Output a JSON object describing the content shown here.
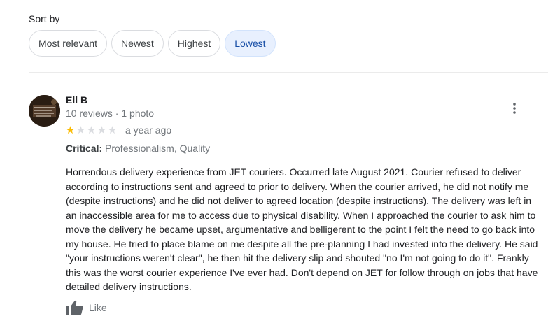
{
  "sort": {
    "label": "Sort by",
    "options": [
      {
        "label": "Most relevant",
        "active": false
      },
      {
        "label": "Newest",
        "active": false
      },
      {
        "label": "Highest",
        "active": false
      },
      {
        "label": "Lowest",
        "active": true
      }
    ]
  },
  "review": {
    "author": "Ell B",
    "meta": "10 reviews · 1 photo",
    "rating": 1,
    "rating_max": 5,
    "time": "a year ago",
    "critical_label": "Critical:",
    "critical_values": "Professionalism, Quality",
    "text": "Horrendous delivery experience from JET couriers. Occurred late August 2021. Courier refused to deliver according to instructions sent and agreed to prior to delivery. When the courier arrived, he did not notify me (despite instructions) and he did not deliver to agreed location (despite instructions).  The delivery was left in an inaccessible area for me to access due to physical disability. When I approached the courier to ask him to move the delivery he became upset, argumentative and belligerent to the point I felt the need to go back into my house. He tried to place blame on me despite all the pre-planning I had invested into the delivery. He said \"your instructions weren't clear\", he then hit the delivery slip and shouted \"no I'm not going to do it\". Frankly this was the worst courier experience I've ever had. Don't depend on JET for follow through on jobs that have detailed delivery instructions.",
    "like_label": "Like"
  },
  "colors": {
    "star_filled": "#fbbc04",
    "star_empty": "#dadce0",
    "active_chip_bg": "#e8f0fe",
    "active_chip_text": "#174ea6"
  },
  "icons": {
    "menu": "more-vert-icon",
    "like": "thumb-up-icon"
  }
}
